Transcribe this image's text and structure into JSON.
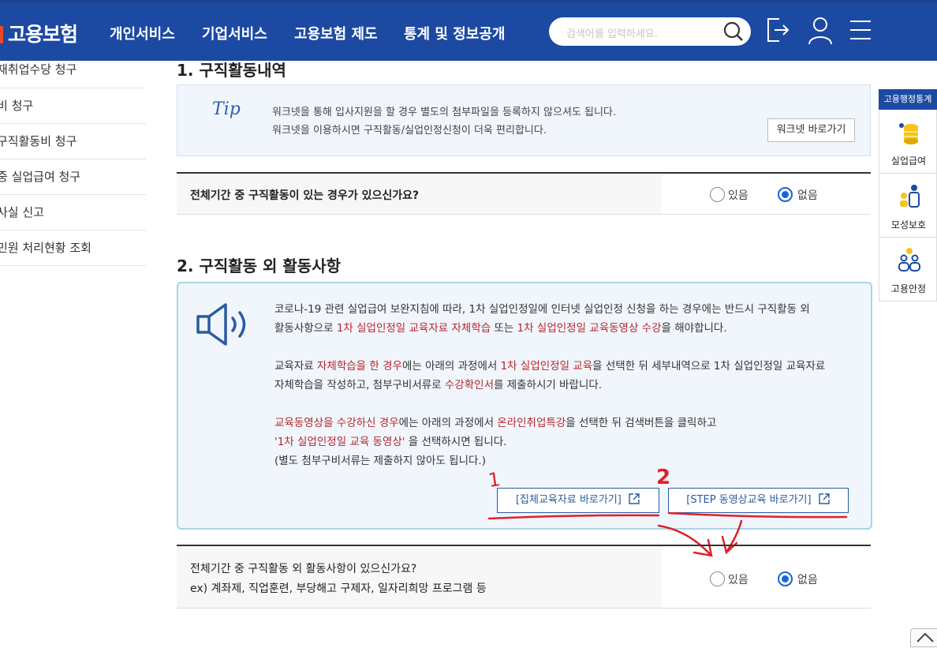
{
  "header": {
    "logo": "고용보험",
    "nav": [
      "개인서비스",
      "기업서비스",
      "고용보험 제도",
      "통계 및 정보공개"
    ],
    "search_placeholder": "검색어를 입력하세요."
  },
  "sidebar": {
    "items": [
      "재취업수당 청구",
      "비 청구",
      "구직활동비 청구",
      "중 실업급여 청구",
      "사실 신고",
      "민원 처리현황 조회"
    ]
  },
  "section1": {
    "title": "1. 구직활동내역",
    "tip_logo": "Tip",
    "tip_lines": [
      "워크넷을 통해 입사지원을 할 경우 별도의 첨부파일을 등록하지 않으셔도 됩니다.",
      "워크넷을 이용하시면 구직활동/실업인정신청이 더욱 편리합니다."
    ],
    "worknet_button": "워크넷 바로가기",
    "question": "전체기간 중 구직활동이 있는 경우가 있으신가요?",
    "yes": "있음",
    "no": "없음",
    "selected": "없음"
  },
  "section2": {
    "title": "2. 구직활동 외 활동사항",
    "p1_a": "코로나-19 관련 실업급여 보완지침에 따라, 1차 실업인정일에 인터넷 실업인정 신청을 하는 경우에는 반드시 구직활동 외",
    "p1_b1": "활동사항으로 ",
    "p1_b2": "1차 실업인정일 교육자료 자체학습",
    "p1_b3": " 또는 ",
    "p1_b4": "1차 실업인정일 교육동영상 수강",
    "p1_b5": "을 해야합니다.",
    "p2_a1": "교육자료 ",
    "p2_a2": "자체학습을 한 경우",
    "p2_a3": "에는 아래의 과정에서 ",
    "p2_a4": "1차 실업인정일 교육",
    "p2_a5": "을 선택한 뒤 세부내역으로 1차 실업인정일 교육자료",
    "p2_b1": "자체학습을 작성하고, 첨부구비서류로 ",
    "p2_b2": "수강확인서",
    "p2_b3": "를 제출하시기 바랍니다.",
    "p3_a1": "교육동영상을 수강하신 경우",
    "p3_a2": "에는 아래의 과정에서 ",
    "p3_a3": "온라인취업특강",
    "p3_a4": "을 선택한 뒤 검색버튼을 클릭하고",
    "p3_b1": "'1차 실업인정일 교육 동영상'",
    "p3_b2": " 을 선택하시면 됩니다.",
    "p3_c": "(별도 첨부구비서류는 제출하지 않아도 됩니다.)",
    "btn1": "[집체교육자료 바로가기]",
    "btn2": "[STEP 동영상교육 바로가기]",
    "annot1": "1",
    "annot2": "2",
    "question_line1": "전체기간 중 구직활동 외 활동사항이 있으신가요?",
    "question_line2": "ex) 계좌제, 직업훈련, 부당해고 구제자, 일자리희망 프로그램 등",
    "yes": "있음",
    "no": "없음",
    "selected": "없음"
  },
  "quick": {
    "header": "고용행정통계",
    "items": [
      "실업급여",
      "모성보호",
      "고용안정"
    ]
  },
  "colors": {
    "brand": "#1c4aa3",
    "accent_red": "#b8262a",
    "annotation_red": "#e0202a",
    "radio_blue": "#1a64d4"
  }
}
